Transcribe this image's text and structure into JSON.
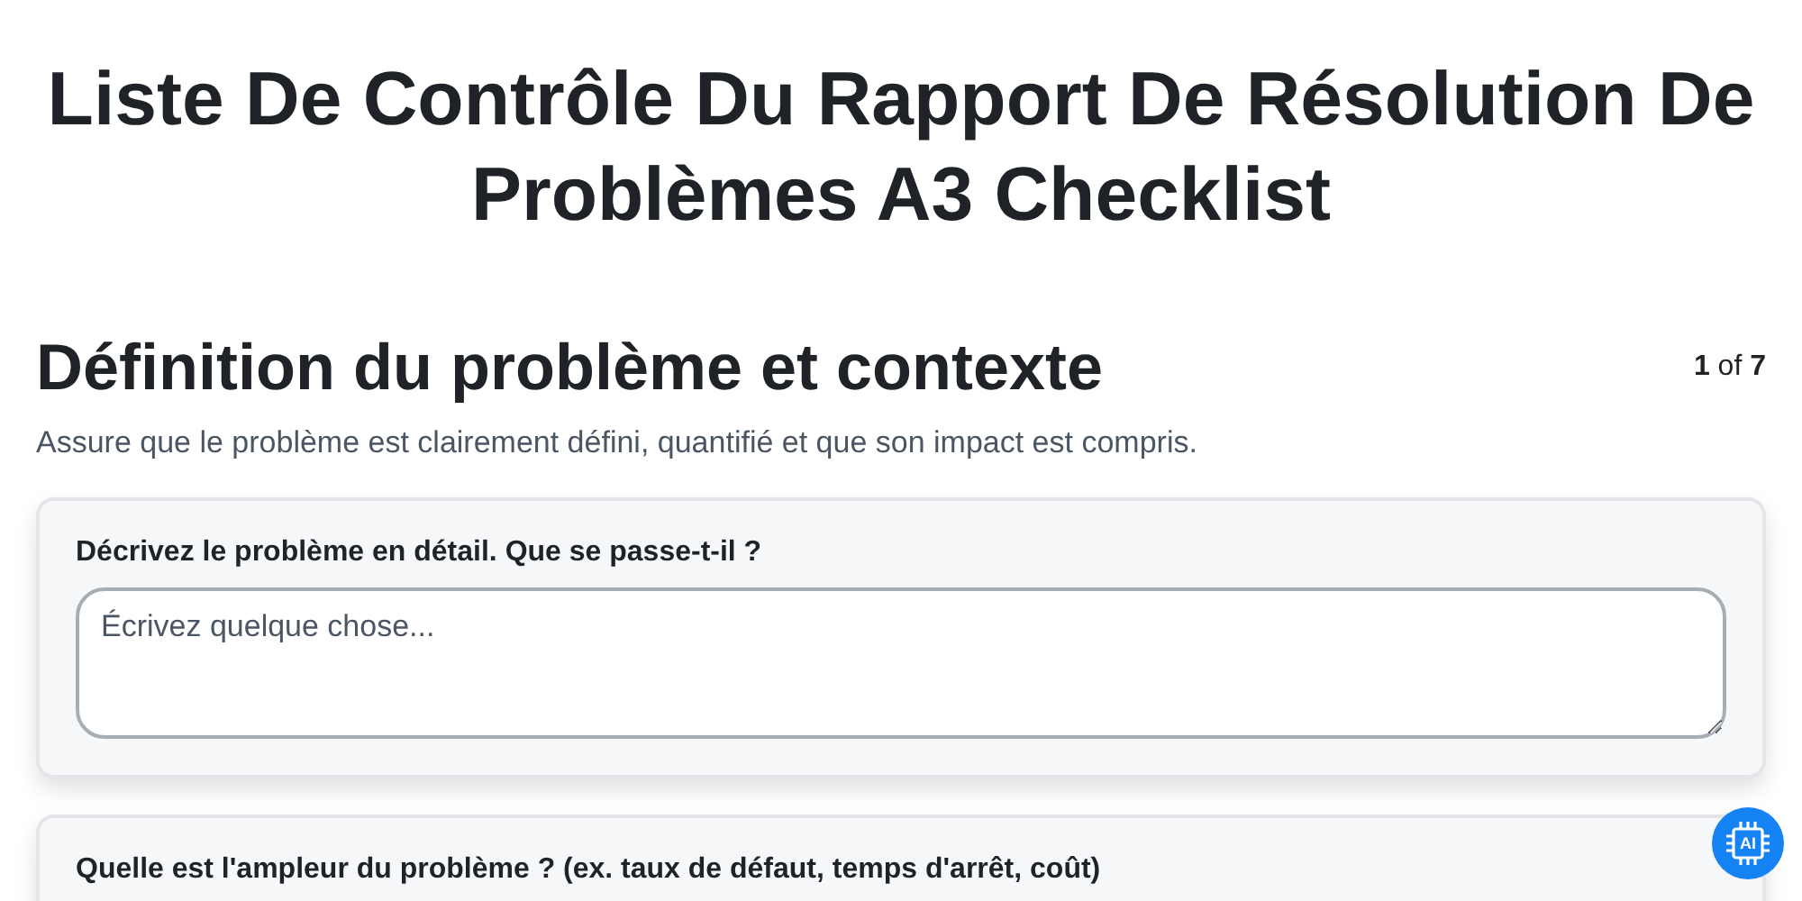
{
  "title": "Liste De Contrôle Du Rapport De Résolution De Problèmes A3 Checklist",
  "section": {
    "heading": "Définition du problème et contexte",
    "page_current": "1",
    "page_of": "of",
    "page_total": "7",
    "description": "Assure que le problème est clairement défini, quantifié et que son impact est compris."
  },
  "questions": [
    {
      "label": "Décrivez le problème en détail. Que se passe-t-il ?",
      "placeholder": "Écrivez quelque chose..."
    },
    {
      "label": "Quelle est l'ampleur du problème ? (ex. taux de défaut, temps d'arrêt, coût)"
    }
  ],
  "ai_button": {
    "label": "AI"
  }
}
